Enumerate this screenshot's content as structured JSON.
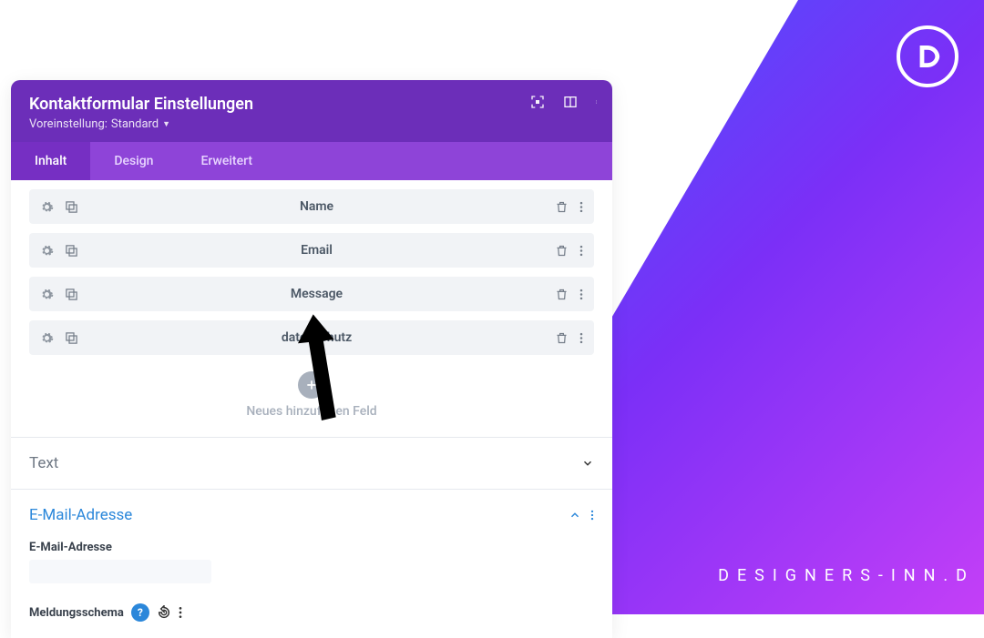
{
  "header": {
    "title": "Kontaktformular Einstellungen",
    "preset_prefix": "Voreinstellung:",
    "preset_value": "Standard"
  },
  "tabs": [
    {
      "label": "Inhalt",
      "active": true
    },
    {
      "label": "Design",
      "active": false
    },
    {
      "label": "Erweitert",
      "active": false
    }
  ],
  "fields": [
    {
      "label": "Name"
    },
    {
      "label": "Email"
    },
    {
      "label": "Message"
    },
    {
      "label": "datenschutz"
    }
  ],
  "add": {
    "label": "Neues hinzufügen Feld"
  },
  "sections": {
    "text": {
      "title": "Text",
      "open": false
    },
    "email": {
      "title": "E-Mail-Adresse",
      "open": true,
      "field_label": "E-Mail-Adresse"
    },
    "meldung": {
      "label": "Meldungsschema"
    }
  },
  "brand": {
    "site": "DESIGNERS-INN.D"
  },
  "colors": {
    "header": "#6c2eb9",
    "tabbar": "#8e44d8",
    "active_tab": "#762fc3",
    "link": "#2b87da"
  }
}
